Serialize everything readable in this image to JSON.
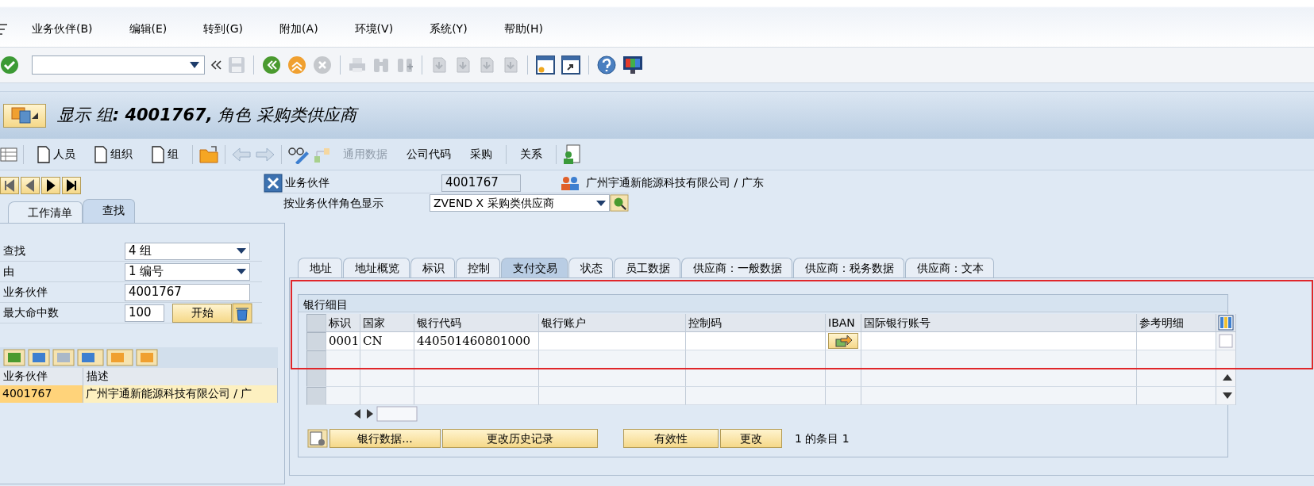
{
  "menu": [
    "业务伙伴(B)",
    "编辑(E)",
    "转到(G)",
    "附加(A)",
    "环境(V)",
    "系统(Y)",
    "帮助(H)"
  ],
  "title": "显示 组**: 4001767,** 角色 采购类供应商",
  "app_toolbar": [
    {
      "kind": "doc",
      "label": "人员",
      "disabled": false
    },
    {
      "kind": "doc",
      "label": "组织",
      "disabled": false
    },
    {
      "kind": "doc",
      "label": "组",
      "disabled": false
    },
    {
      "kind": "text",
      "label": "通用数据",
      "disabled": true
    },
    {
      "kind": "text",
      "label": "公司代码",
      "disabled": false
    },
    {
      "kind": "text",
      "label": "采购",
      "disabled": false
    },
    {
      "kind": "text",
      "label": "关系",
      "disabled": false
    }
  ],
  "left": {
    "tabs": [
      {
        "label": "工作清单",
        "selected": false
      },
      {
        "label": "查找",
        "selected": true
      }
    ],
    "search": [
      {
        "kind": "dropdown",
        "label": "查找",
        "value": "4 组"
      },
      {
        "kind": "dropdown",
        "label": "由",
        "value": "1 编号"
      },
      {
        "kind": "input",
        "label": "业务伙伴",
        "value": "4001767"
      },
      {
        "kind": "max",
        "label": "最大命中数",
        "value": "100",
        "button": "开始"
      }
    ],
    "results": {
      "columns": [
        "业务伙伴",
        "描述"
      ],
      "rows": [
        {
          "cells": [
            "4001767",
            "广州宇通新能源科技有限公司 / 广"
          ],
          "selected": true
        }
      ]
    }
  },
  "partner": {
    "label": "业务伙伴",
    "value": "4001767",
    "name": "广州宇通新能源科技有限公司 / 广东"
  },
  "role": {
    "label": "按业务伙伴角色显示",
    "value": "ZVEND X 采购类供应商"
  },
  "tabs": [
    {
      "label": "地址",
      "selected": false
    },
    {
      "label": "地址概览",
      "selected": false
    },
    {
      "label": "标识",
      "selected": false
    },
    {
      "label": "控制",
      "selected": false
    },
    {
      "label": "支付交易",
      "selected": true
    },
    {
      "label": "状态",
      "selected": false
    },
    {
      "label": "员工数据",
      "selected": false
    },
    {
      "label": "供应商：一般数据",
      "selected": false
    },
    {
      "label": "供应商：税务数据",
      "selected": false
    },
    {
      "label": "供应商：文本",
      "selected": false
    }
  ],
  "bank": {
    "title": "银行细目",
    "columns": [
      "标识",
      "国家",
      "银行代码",
      "银行账户",
      "控制码",
      "IBAN",
      "国际银行账号",
      "参考明细"
    ],
    "rows": [
      {
        "id": "0001",
        "country": "CN",
        "bank_code": "440501460801000"
      }
    ],
    "buttons": [
      "银行数据...",
      "更改历史记录",
      "有效性",
      "更改"
    ],
    "entry_count": "1 的条目 1"
  }
}
